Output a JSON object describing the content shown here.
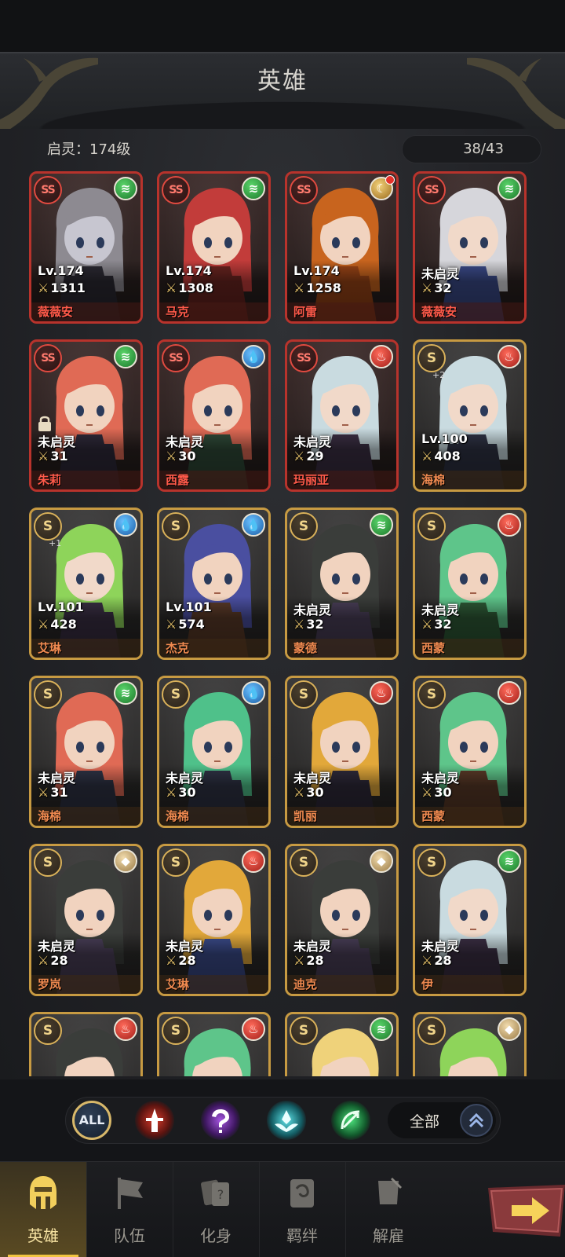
{
  "header": {
    "title": "英雄"
  },
  "summary": {
    "spirit_level": "启灵：174级",
    "hero_count": "38/43"
  },
  "heroes": [
    {
      "rank": "SS",
      "element": "wind",
      "level": "Lv.174",
      "power": "1311",
      "name": "薇薇安",
      "hair": "#8d8a91",
      "outfit": "#2c2a33",
      "skin": "#c7c6d0"
    },
    {
      "rank": "SS",
      "element": "wind",
      "level": "Lv.174",
      "power": "1308",
      "name": "马克",
      "hair": "#c23c3a",
      "outfit": "#6a2420",
      "skin": "#f1d3bf"
    },
    {
      "rank": "SS",
      "element": "moon",
      "level": "Lv.174",
      "power": "1258",
      "name": "阿雷",
      "hair": "#c8641e",
      "outfit": "#9a4416",
      "skin": "#f1d3bf",
      "red_dot": true
    },
    {
      "rank": "SS",
      "element": "wind",
      "level": "未启灵",
      "power": "32",
      "name": "薇薇安",
      "hair": "#d6d6db",
      "outfit": "#3b4b8a",
      "skin": "#f1d9c9"
    },
    {
      "rank": "SS",
      "element": "wind",
      "level": "未启灵",
      "power": "31",
      "name": "朱莉",
      "hair": "#e06a55",
      "outfit": "#2f2a3a",
      "skin": "#f1d3bf",
      "locked": true
    },
    {
      "rank": "SS",
      "element": "water",
      "level": "未启灵",
      "power": "30",
      "name": "西露",
      "hair": "#e06a55",
      "outfit": "#2f4a38",
      "skin": "#f1d3bf"
    },
    {
      "rank": "SS",
      "element": "fire",
      "level": "未启灵",
      "power": "29",
      "name": "玛丽亚",
      "hair": "#c9dbe0",
      "outfit": "#3b2f44",
      "skin": "#f1d9c9"
    },
    {
      "rank": "S",
      "element": "fire",
      "level": "Lv.100",
      "power": "408",
      "name": "海棉",
      "hair": "#c9dbe0",
      "outfit": "#2f3345",
      "skin": "#f1d9c9",
      "plus": "+2"
    },
    {
      "rank": "S",
      "element": "water",
      "level": "Lv.101",
      "power": "428",
      "name": "艾琳",
      "hair": "#8ed45a",
      "outfit": "#3a2f44",
      "skin": "#f1d9c9",
      "plus": "+1"
    },
    {
      "rank": "S",
      "element": "water",
      "level": "Lv.101",
      "power": "574",
      "name": "杰克",
      "hair": "#4a4fa0",
      "outfit": "#5a3a28",
      "skin": "#f1d3bf"
    },
    {
      "rank": "S",
      "element": "wind",
      "level": "未启灵",
      "power": "32",
      "name": "蒙德",
      "hair": "#3a3d3a",
      "outfit": "#4a3f58",
      "skin": "#f1d3bf"
    },
    {
      "rank": "S",
      "element": "fire",
      "level": "未启灵",
      "power": "32",
      "name": "西蒙",
      "hair": "#5ec58a",
      "outfit": "#2e5a36",
      "skin": "#f1d3bf"
    },
    {
      "rank": "S",
      "element": "wind",
      "level": "未启灵",
      "power": "31",
      "name": "海棉",
      "hair": "#e06a55",
      "outfit": "#2f3345",
      "skin": "#f1d3bf"
    },
    {
      "rank": "S",
      "element": "water",
      "level": "未启灵",
      "power": "30",
      "name": "海棉",
      "hair": "#4fc18a",
      "outfit": "#2f3345",
      "skin": "#f1d3bf"
    },
    {
      "rank": "S",
      "element": "fire",
      "level": "未启灵",
      "power": "30",
      "name": "凯丽",
      "hair": "#e2a83a",
      "outfit": "#2f2a3a",
      "skin": "#f1d3bf"
    },
    {
      "rank": "S",
      "element": "fire",
      "level": "未启灵",
      "power": "30",
      "name": "西蒙",
      "hair": "#5ec58a",
      "outfit": "#5a3a28",
      "skin": "#f1d3bf"
    },
    {
      "rank": "S",
      "element": "earth",
      "level": "未启灵",
      "power": "28",
      "name": "罗岚",
      "hair": "#3a3d3a",
      "outfit": "#4a3f58",
      "skin": "#f1d3bf"
    },
    {
      "rank": "S",
      "element": "fire",
      "level": "未启灵",
      "power": "28",
      "name": "艾琳",
      "hair": "#e2a83a",
      "outfit": "#3b4b8a",
      "skin": "#f1d3bf"
    },
    {
      "rank": "S",
      "element": "earth",
      "level": "未启灵",
      "power": "28",
      "name": "迪克",
      "hair": "#3a3d3a",
      "outfit": "#4a3f58",
      "skin": "#f1d3bf"
    },
    {
      "rank": "S",
      "element": "wind",
      "level": "未启灵",
      "power": "28",
      "name": "伊",
      "hair": "#c9dbe0",
      "outfit": "#3b2f44",
      "skin": "#f1d9c9"
    },
    {
      "rank": "S",
      "element": "fire",
      "level": "",
      "power": "",
      "name": "",
      "hair": "#3a3d3a",
      "outfit": "#2f2a3a",
      "skin": "#f1d3bf",
      "partial": true
    },
    {
      "rank": "S",
      "element": "fire",
      "level": "",
      "power": "",
      "name": "",
      "hair": "#5ec58a",
      "outfit": "#2f2a3a",
      "skin": "#f1d3bf",
      "partial": true
    },
    {
      "rank": "S",
      "element": "wind",
      "level": "",
      "power": "",
      "name": "",
      "hair": "#efd27a",
      "outfit": "#2f2a3a",
      "skin": "#f1d3bf",
      "partial": true
    },
    {
      "rank": "S",
      "element": "earth",
      "level": "",
      "power": "",
      "name": "",
      "hair": "#8ed45a",
      "outfit": "#2f2a3a",
      "skin": "#f1d3bf",
      "partial": true
    }
  ],
  "filters": {
    "all_label": "ALL",
    "class_filters": [
      "warrior-class-icon",
      "mystic-class-icon",
      "support-class-icon",
      "ranger-class-icon"
    ],
    "dropdown_label": "全部"
  },
  "nav": {
    "tabs": [
      {
        "label": "英雄",
        "icon": "helmet-icon",
        "active": true
      },
      {
        "label": "队伍",
        "icon": "flag-icon",
        "active": false
      },
      {
        "label": "化身",
        "icon": "cards-icon",
        "active": false
      },
      {
        "label": "羁绊",
        "icon": "scroll-icon",
        "active": false
      },
      {
        "label": "解雇",
        "icon": "dismiss-icon",
        "active": false
      }
    ]
  },
  "colors": {
    "ss_border": "#b8332c",
    "s_border": "#c79a42",
    "active_tab": "#f2c441"
  }
}
